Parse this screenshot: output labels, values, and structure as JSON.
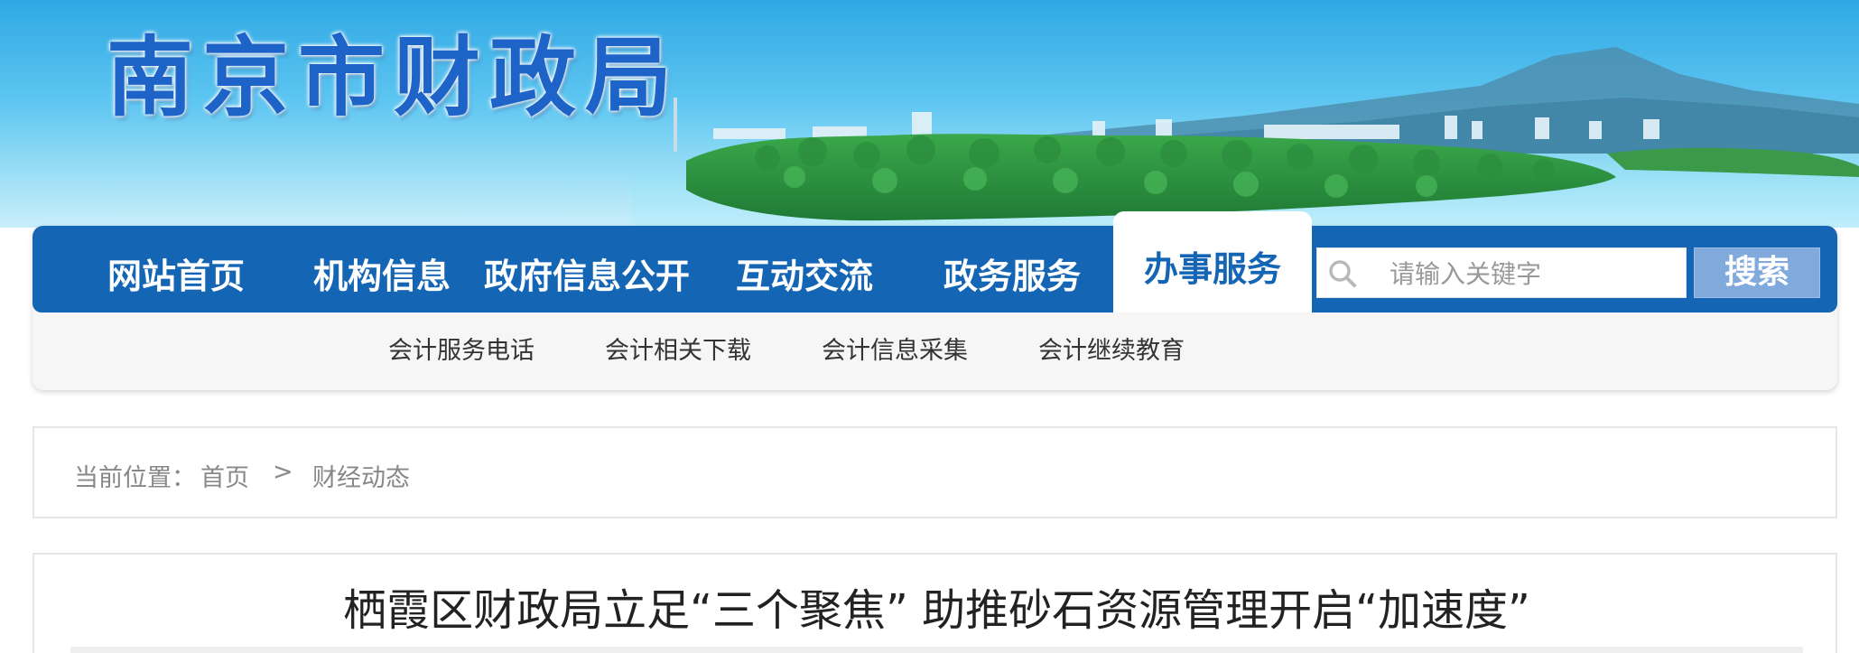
{
  "header": {
    "site_title": "南京市财政局"
  },
  "nav": {
    "items": [
      {
        "label": "网站首页"
      },
      {
        "label": "机构信息"
      },
      {
        "label": "政府信息公开"
      },
      {
        "label": "互动交流"
      },
      {
        "label": "政务服务"
      },
      {
        "label": "办事服务"
      }
    ],
    "active_label": "办事服务"
  },
  "search": {
    "placeholder": "请输入关键字",
    "button_label": "搜索"
  },
  "subnav": {
    "items": [
      {
        "label": "会计服务电话"
      },
      {
        "label": "会计相关下载"
      },
      {
        "label": "会计信息采集"
      },
      {
        "label": "会计继续教育"
      }
    ]
  },
  "breadcrumb": {
    "prefix": "当前位置：",
    "home": "首页",
    "separator": ">",
    "current": "财经动态"
  },
  "article": {
    "title": "栖霞区财政局立足“三个聚焦” 助推砂石资源管理开启“加速度”"
  },
  "colors": {
    "nav_blue": "#1565b5",
    "search_button": "#80aadc",
    "logo_blue": "#1e64c8"
  },
  "icons": {
    "search": "search-icon"
  }
}
